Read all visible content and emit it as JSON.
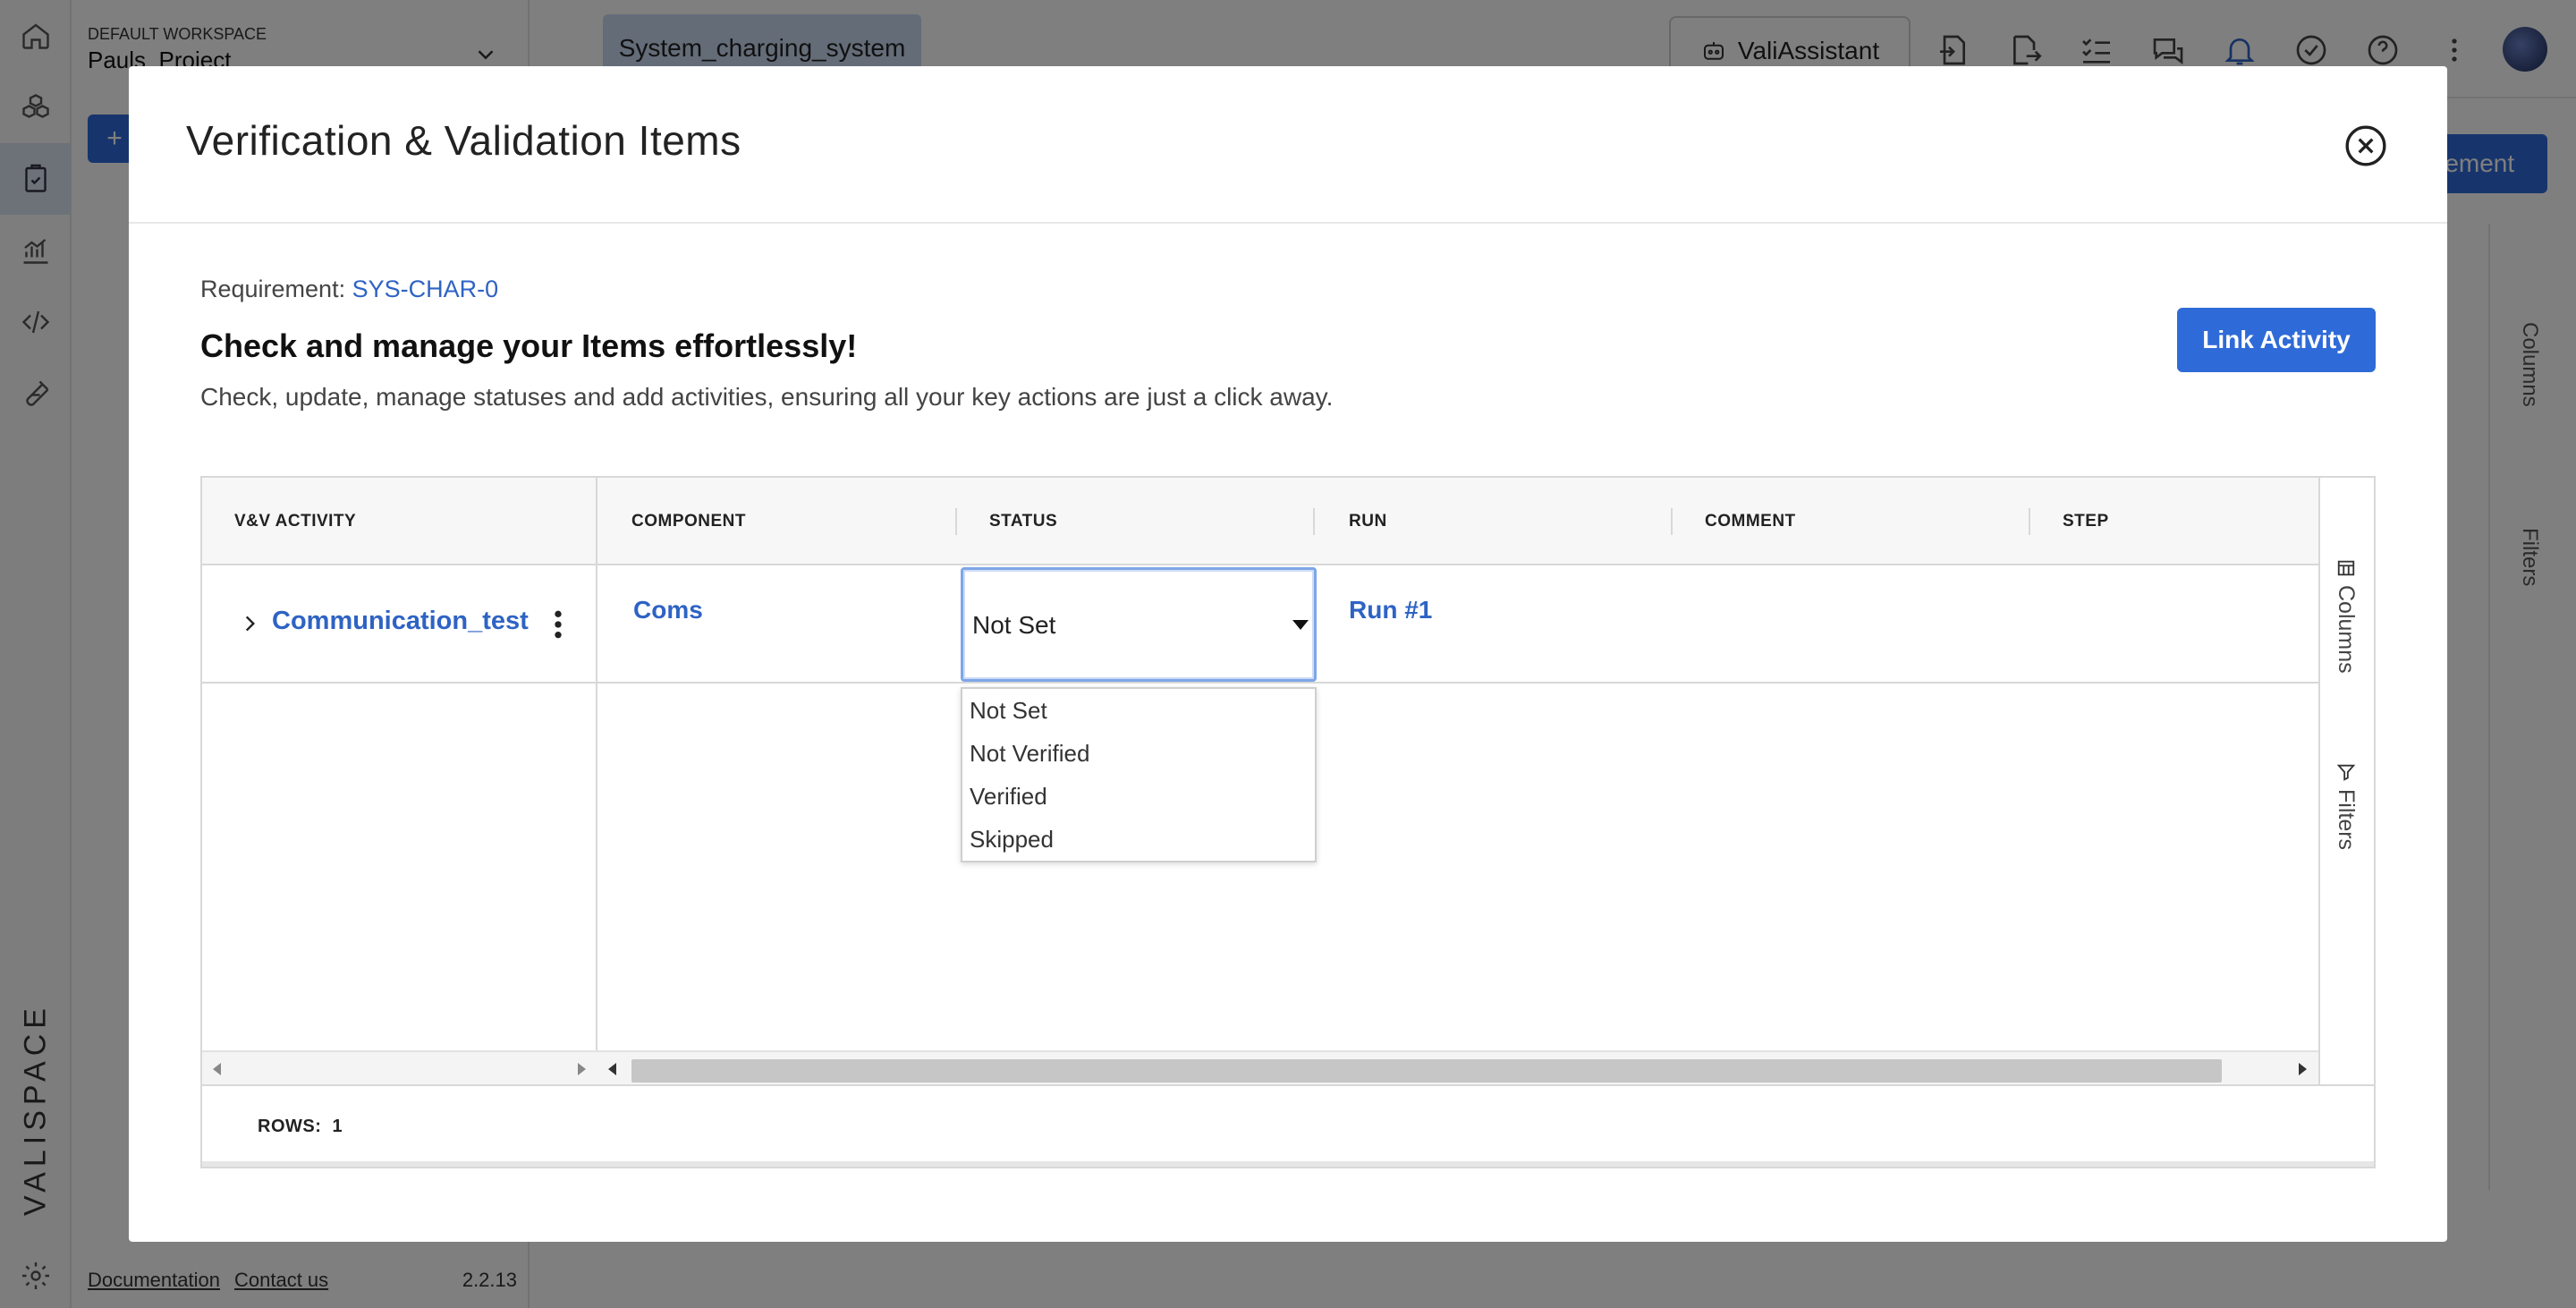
{
  "sidebar": {
    "workspace_label": "DEFAULT WORKSPACE",
    "project_name": "Pauls_Project",
    "brand": "VALISPACE",
    "footer": {
      "documentation": "Documentation",
      "contact": "Contact us",
      "version": "2.2.13"
    }
  },
  "topbar": {
    "active_tab": "System_charging_system",
    "assistant_label": "ValiAssistant",
    "add_label": "+",
    "new_requirement_label": "rement"
  },
  "background_panel": {
    "columns_label": "Columns",
    "filters_label": "Filters"
  },
  "modal": {
    "title": "Verification & Validation Items",
    "requirement_prefix": "Requirement:",
    "requirement_id": "SYS-CHAR-0",
    "headline": "Check and manage your Items effortlessly!",
    "subline": "Check, update, manage statuses and add activities, ensuring all your key actions are just a click away.",
    "link_activity_label": "Link Activity",
    "grid": {
      "columns": [
        "V&V ACTIVITY",
        "COMPONENT",
        "STATUS",
        "RUN",
        "COMMENT",
        "STEP"
      ],
      "rows": [
        {
          "activity": "Communication_test",
          "component": "Coms",
          "status": "Not Set",
          "run": "Run #1",
          "comment": "",
          "step": ""
        }
      ],
      "status_options": [
        "Not Set",
        "Not Verified",
        "Verified",
        "Skipped"
      ],
      "side_columns_label": "Columns",
      "side_filters_label": "Filters",
      "rows_label": "ROWS:",
      "rows_count": "1"
    }
  },
  "colors": {
    "accent": "#2f6bd8",
    "link": "#2e63c4"
  }
}
